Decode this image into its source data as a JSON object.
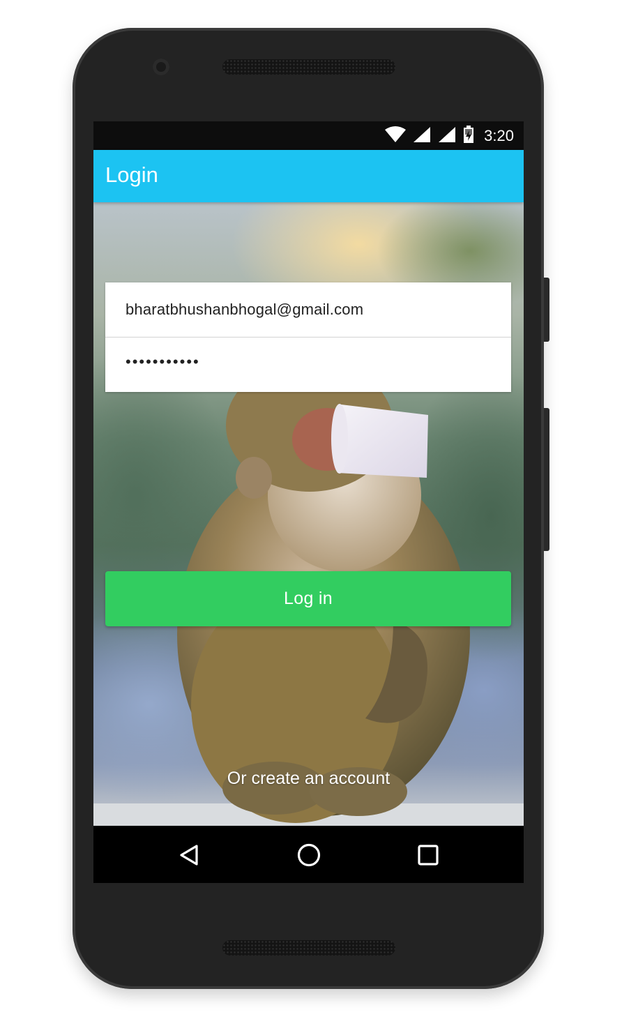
{
  "status_bar": {
    "time": "3:20",
    "icons": [
      "wifi-icon",
      "signal-icon",
      "signal-icon",
      "battery-charging-icon"
    ]
  },
  "app_bar": {
    "title": "Login",
    "color": "#1cc3f2"
  },
  "form": {
    "email_value": "bharatbhushanbhogal@gmail.com",
    "password_value": "•••••••••••",
    "login_label": "Log in",
    "login_color": "#32cd60",
    "create_account_label": "Or create an account"
  },
  "nav_bar": {
    "buttons": [
      "back-icon",
      "home-icon",
      "recents-icon"
    ]
  }
}
